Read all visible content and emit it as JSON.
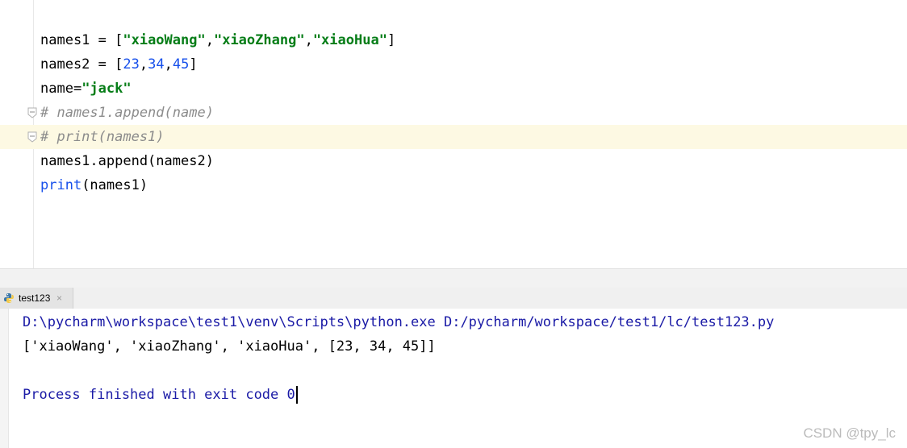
{
  "editor": {
    "lines": [
      {
        "parts": [
          {
            "t": "names1 = [",
            "c": ""
          },
          {
            "t": "\"xiaoWang\"",
            "c": "str"
          },
          {
            "t": ",",
            "c": ""
          },
          {
            "t": "\"xiaoZhang\"",
            "c": "str"
          },
          {
            "t": ",",
            "c": ""
          },
          {
            "t": "\"xiaoHua\"",
            "c": "str"
          },
          {
            "t": "]",
            "c": ""
          }
        ]
      },
      {
        "parts": [
          {
            "t": "names2 = [",
            "c": ""
          },
          {
            "t": "23",
            "c": "num"
          },
          {
            "t": ",",
            "c": ""
          },
          {
            "t": "34",
            "c": "num"
          },
          {
            "t": ",",
            "c": ""
          },
          {
            "t": "45",
            "c": "num"
          },
          {
            "t": "]",
            "c": ""
          }
        ]
      },
      {
        "parts": [
          {
            "t": "name=",
            "c": ""
          },
          {
            "t": "\"jack\"",
            "c": "str"
          }
        ]
      },
      {
        "parts": [
          {
            "t": "# names1.append(name)",
            "c": "cmt"
          }
        ],
        "fold": true
      },
      {
        "parts": [
          {
            "t": "# print(names1)",
            "c": "cmt"
          }
        ],
        "fold": true,
        "current": true
      },
      {
        "parts": [
          {
            "t": "names1.append(names2)",
            "c": ""
          }
        ]
      },
      {
        "parts": [
          {
            "t": "print",
            "c": "num"
          },
          {
            "t": "(names1)",
            "c": ""
          }
        ]
      }
    ]
  },
  "run": {
    "tab_label": "test123",
    "tab_icon": "python-icon",
    "close_glyph": "×"
  },
  "console": {
    "command": "D:\\pycharm\\workspace\\test1\\venv\\Scripts\\python.exe D:/pycharm/workspace/test1/lc/test123.py",
    "output": "['xiaoWang', 'xiaoZhang', 'xiaoHua', [23, 34, 45]]",
    "exit": "Process finished with exit code 0"
  },
  "watermark": "CSDN @tpy_lc",
  "colors": {
    "string": "#067d17",
    "number": "#1750eb",
    "comment": "#8c8c8c",
    "current_line": "#fdf9e3",
    "console_text": "#1a1aa6"
  }
}
